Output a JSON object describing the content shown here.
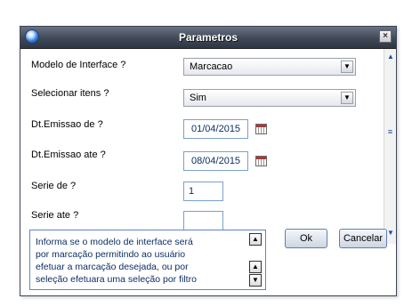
{
  "window": {
    "title": "Parametros",
    "close_label": "×"
  },
  "form": {
    "modelo": {
      "label": "Modelo de Interface ?",
      "value": "Marcacao"
    },
    "selecionar": {
      "label": "Selecionar itens ?",
      "value": "Sim"
    },
    "dt_de": {
      "label": "Dt.Emissao de ?",
      "value": "01/04/2015"
    },
    "dt_ate": {
      "label": "Dt.Emissao ate ?",
      "value": "08/04/2015"
    },
    "serie_de": {
      "label": "Serie de ?",
      "value": "1"
    },
    "serie_ate": {
      "label": "Serie ate ?",
      "value": ""
    }
  },
  "help": {
    "lines": [
      "Informa se o modelo de interface será",
      "por marcação permitindo ao usuário",
      "efetuar a marcação desejada, ou por",
      "seleção efetuara uma seleção por filtro"
    ]
  },
  "buttons": {
    "ok": "Ok",
    "cancel": "Cancelar"
  },
  "icons": {
    "scroll_up": "▲",
    "scroll_down": "▼",
    "dropdown": "▼",
    "grip": "≡",
    "help_up": "▲",
    "help_down": "▼"
  },
  "colors": {
    "titlebar": "#404957",
    "field_border": "#7ba0cf",
    "help_text": "#0b2f66"
  }
}
